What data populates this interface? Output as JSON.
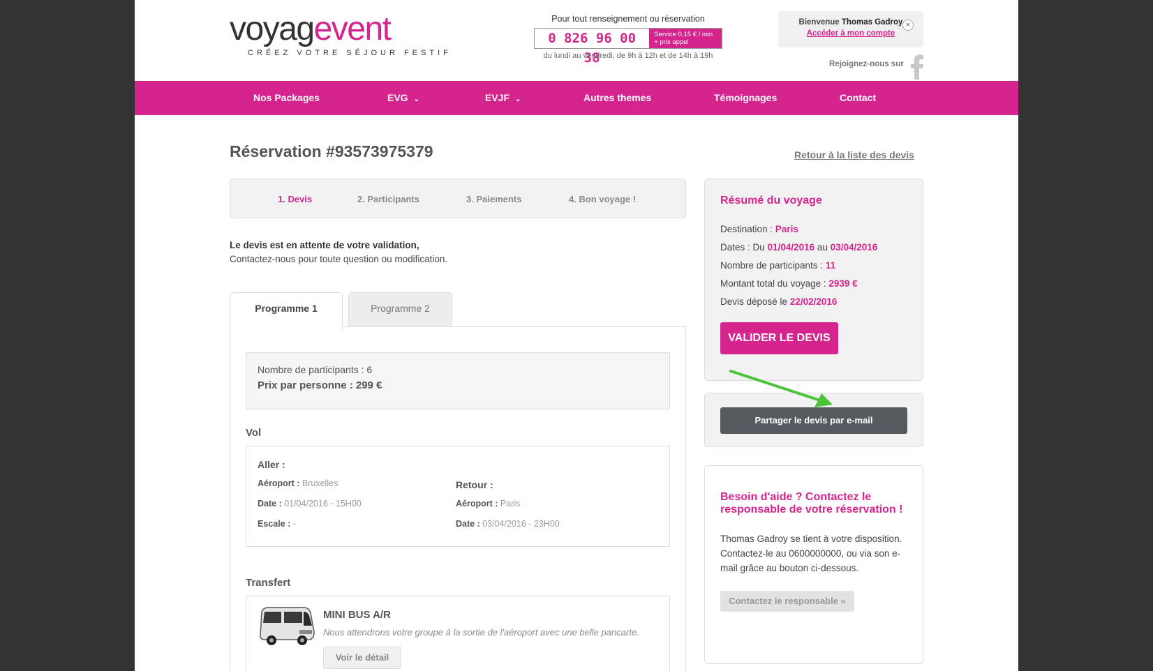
{
  "header": {
    "logo_part1": "voyag",
    "logo_part2": "event",
    "logo_tagline": "CRÉEZ VOTRE SÉJOUR FESTIF",
    "contact_top": "Pour tout renseignement ou réservation",
    "phone": "0 826 96 00 38",
    "phone_service_1": "Service 0,15 € / min",
    "phone_service_2": "+ prix appel",
    "contact_hours": "du lundi au vendredi, de 9h à 12h et de 14h à 19h",
    "welcome_prefix": "Bienvenue",
    "welcome_name": "Thomas Gadroy",
    "account_link": "Accéder à mon compte",
    "close": "×",
    "join_label": "Rejoignez-nous sur"
  },
  "nav": {
    "items": [
      {
        "label": "Nos Packages"
      },
      {
        "label": "EVG",
        "chevron": "⌄"
      },
      {
        "label": "EVJF",
        "chevron": "⌄"
      },
      {
        "label": "Autres themes"
      },
      {
        "label": "Témoignages"
      },
      {
        "label": "Contact"
      }
    ]
  },
  "main": {
    "title": "Réservation #93573975379",
    "back_link": "Retour à la liste des devis",
    "steps": [
      "1. Devis",
      "2. Participants",
      "3. Paiements",
      "4. Bon voyage !"
    ],
    "status_bold": "Le devis est en attente de votre validation,",
    "status_text": "Contactez-nous pour toute question ou modification.",
    "tabs": [
      "Programme 1",
      "Programme 2"
    ],
    "participants": "Nombre de participants : 6",
    "price": "Prix par personne : 299 €",
    "vol": {
      "title": "Vol",
      "aller_title": "Aller :",
      "aller_airport_label": "Aéroport :",
      "aller_airport": "Bruxelles",
      "aller_date_label": "Date :",
      "aller_date": "01/04/2016 - 15H00",
      "escale_label": "Escale :",
      "escale": "-",
      "retour_title": "Retour :",
      "retour_airport_label": "Aéroport :",
      "retour_airport": "Paris",
      "retour_date_label": "Date :",
      "retour_date": "03/04/2016 - 23H00"
    },
    "transfert": {
      "title": "Transfert",
      "name": "MINI BUS A/R",
      "desc": "Nous attendrons votre groupe à la sortie de l'aéroport avec une belle pancarte.",
      "detail_btn": "Voir le détail"
    }
  },
  "sidebar": {
    "summary_title": "Résumé du voyage",
    "destination_label": "Destination :",
    "destination": "Paris",
    "dates_label": "Dates : Du",
    "date_from": "01/04/2016",
    "dates_mid": "au",
    "date_to": "03/04/2016",
    "participants_label": "Nombre de participants :",
    "participants": "11",
    "total_label": "Montant total du voyage :",
    "total": "2939 €",
    "deposit_label": "Devis déposé le",
    "deposit_date": "22/02/2016",
    "validate_btn": "VALIDER LE DEVIS",
    "share_btn": "Partager le devis par e-mail",
    "help_title": "Besoin d'aide ? Contactez le responsable de votre réservation !",
    "help_text": "Thomas Gadroy se tient à votre disposition. Contactez-le au 0600000000, ou via son e-mail grâce au bouton ci-dessous.",
    "help_btn": "Contactez le responsable »"
  },
  "colors": {
    "brand": "#d6248f",
    "dark_button": "#555a5f",
    "annotation_arrow": "#4cc43a"
  }
}
